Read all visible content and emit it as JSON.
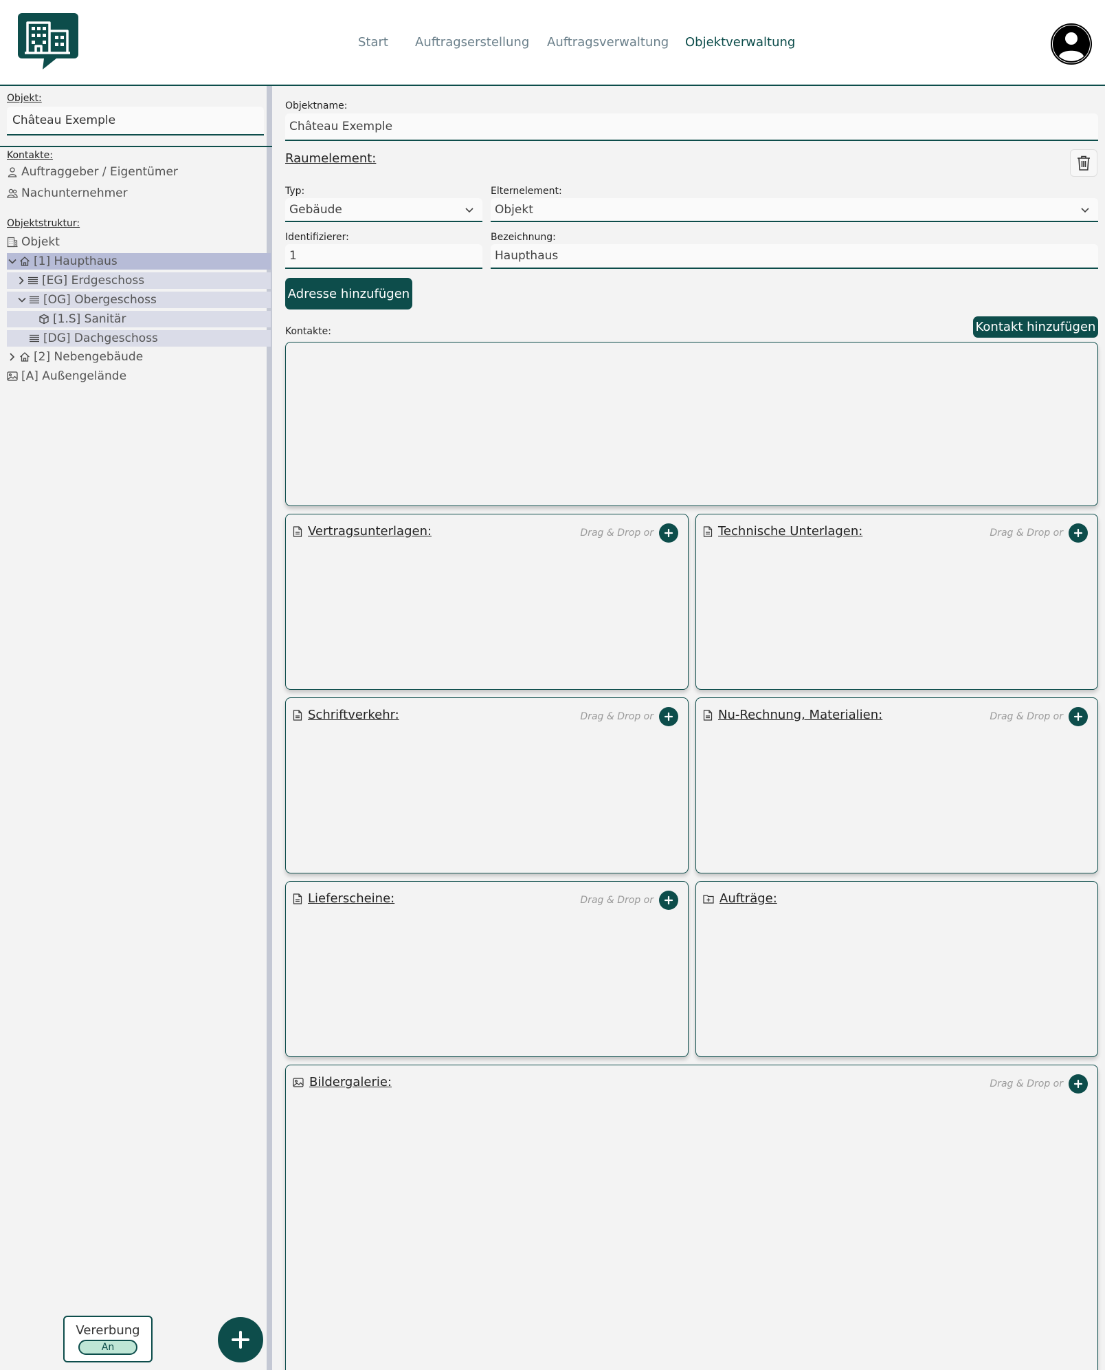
{
  "nav": {
    "items": [
      "Start",
      "Auftragserstellung",
      "Auftragsverwaltung",
      "Objektverwaltung"
    ],
    "active": "Objektverwaltung"
  },
  "sidebar": {
    "object_label": "Objekt:",
    "object_value": "Château Exemple",
    "contacts_label": "Kontakte:",
    "contacts": [
      "Auftraggeber / Eigentümer",
      "Nachunternehmer"
    ],
    "structure_label": "Objektstruktur:",
    "tree": [
      "Objekt",
      "[1] Haupthaus",
      "[EG] Erdgeschoss",
      "[OG] Obergeschoss",
      "[1.S] Sanitär",
      "[DG] Dachgeschoss",
      "[2] Nebengebäude",
      "[A] Außengelände"
    ],
    "inheritance_label": "Vererbung",
    "inheritance_state": "An"
  },
  "main": {
    "objektname_label": "Objektname:",
    "objektname_value": "Château Exemple",
    "raumelement_title": "Raumelement:",
    "typ_label": "Typ:",
    "typ_value": "Gebäude",
    "eltern_label": "Elternelement:",
    "eltern_value": "Objekt",
    "ident_label": "Identifizierer:",
    "ident_value": "1",
    "bez_label": "Bezeichnung:",
    "bez_value": "Haupthaus",
    "add_address": "Adresse hinzufügen",
    "kontakte_label": "Kontakte:",
    "add_contact": "Kontakt hinzufügen",
    "drag_text": "Drag & Drop or",
    "cards": [
      "Vertragsunterlagen:",
      "Technische Unterlagen:",
      "Schriftverkehr:",
      "Nu-Rechnung, Materialien:",
      "Lieferscheine:",
      "Aufträge:",
      "Bildergalerie:"
    ]
  },
  "colors": {
    "primary": "#0d4d4b",
    "selected_row": "#b7bcd7",
    "sub_row": "#dadce8"
  },
  "icons": [
    "building-logo-icon",
    "user-avatar-icon",
    "person-icon",
    "people-icon",
    "building-icon",
    "house-icon",
    "layers-icon",
    "cube-icon",
    "image-icon",
    "document-icon",
    "folder-plus-icon",
    "trash-icon",
    "chevron-down-icon",
    "chevron-right-icon",
    "plus-icon"
  ]
}
